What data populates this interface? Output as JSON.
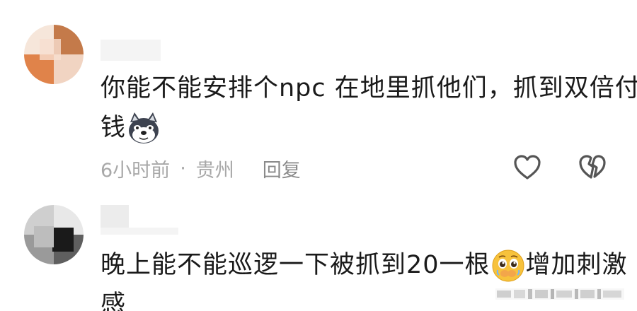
{
  "comments": [
    {
      "text_line1": "你能不能安排个npc 在地里抓他们，抓到双倍付",
      "text_line2": "钱",
      "emoji": "husky-dog-emoji",
      "time": "6小时前",
      "separator": "·",
      "location": "贵州",
      "reply_label": "回复"
    },
    {
      "text_line1": "晚上能不能巡逻一下被抓到20一根",
      "text_line1_after": "增加刺激",
      "text_line2": "感",
      "emoji": "pleading-face-emoji"
    }
  ],
  "colors": {
    "text": "#1a1a1a",
    "meta": "#a8a8a8"
  }
}
